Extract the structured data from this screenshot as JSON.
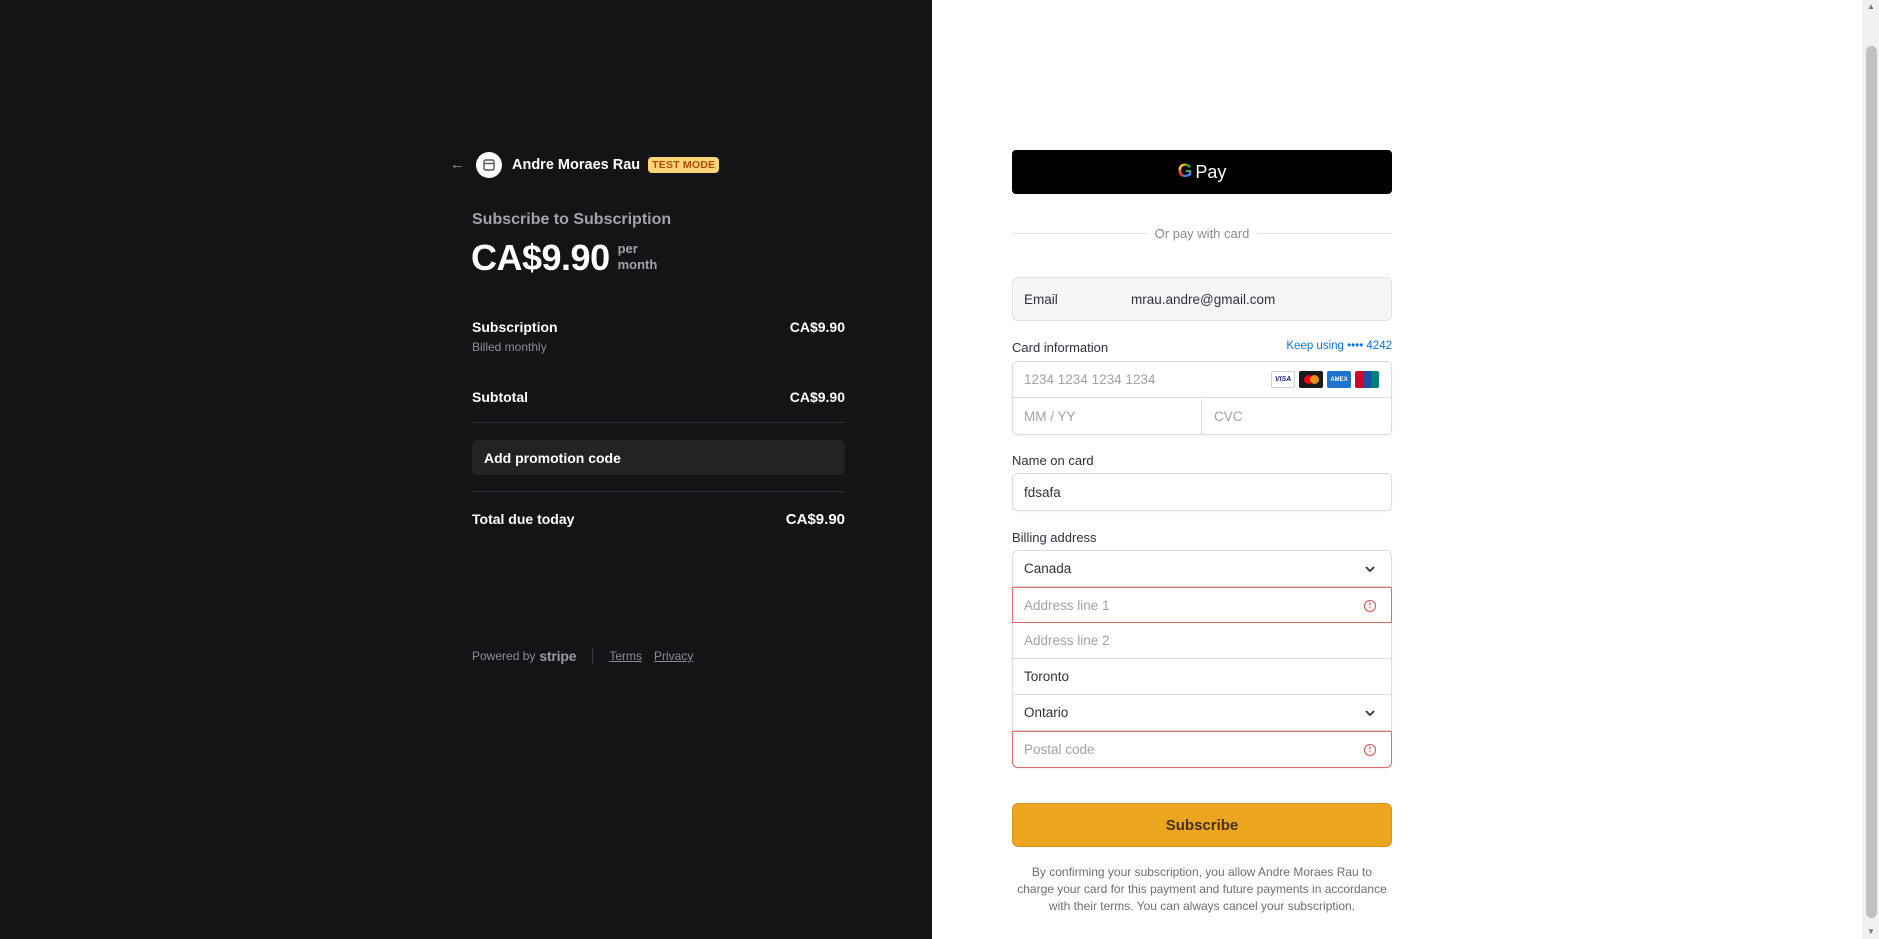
{
  "merchant": {
    "name": "Andre Moraes Rau",
    "badge": "TEST MODE"
  },
  "summary": {
    "subscribe_to": "Subscribe to Subscription",
    "price": "CA$9.90",
    "period_line1": "per",
    "period_line2": "month",
    "items": [
      {
        "label": "Subscription",
        "sublabel": "Billed monthly",
        "amount": "CA$9.90"
      }
    ],
    "subtotal_label": "Subtotal",
    "subtotal_amount": "CA$9.90",
    "promo_label": "Add promotion code",
    "total_label": "Total due today",
    "total_amount": "CA$9.90"
  },
  "footer": {
    "powered_by": "Powered by",
    "stripe": "stripe",
    "terms": "Terms",
    "privacy": "Privacy"
  },
  "payment": {
    "gpay_label": "Pay",
    "or_text": "Or pay with card",
    "email_label": "Email",
    "email_value": "mrau.andre@gmail.com",
    "card_info_label": "Card information",
    "keep_using": "Keep using •••• 4242",
    "card_number_placeholder": "1234 1234 1234 1234",
    "expiry_placeholder": "MM / YY",
    "cvc_placeholder": "CVC",
    "card_brands": [
      "VISA",
      "Mastercard",
      "AMEX",
      "UnionPay"
    ],
    "name_label": "Name on card",
    "name_value": "fdsafa",
    "billing_label": "Billing address",
    "country": "Canada",
    "address1_placeholder": "Address line 1",
    "address2_placeholder": "Address line 2",
    "city": "Toronto",
    "province": "Ontario",
    "postal_placeholder": "Postal code",
    "subscribe_label": "Subscribe",
    "legal": "By confirming your subscription, you allow Andre Moraes Rau to charge your card for this payment and future payments in accordance with their terms. You can always cancel your subscription."
  },
  "colors": {
    "left_bg": "#141416",
    "subscribe_button": "#eba51e",
    "error_border": "#e66b6b",
    "link": "#0a75e0",
    "test_badge_bg": "#fcd579"
  }
}
